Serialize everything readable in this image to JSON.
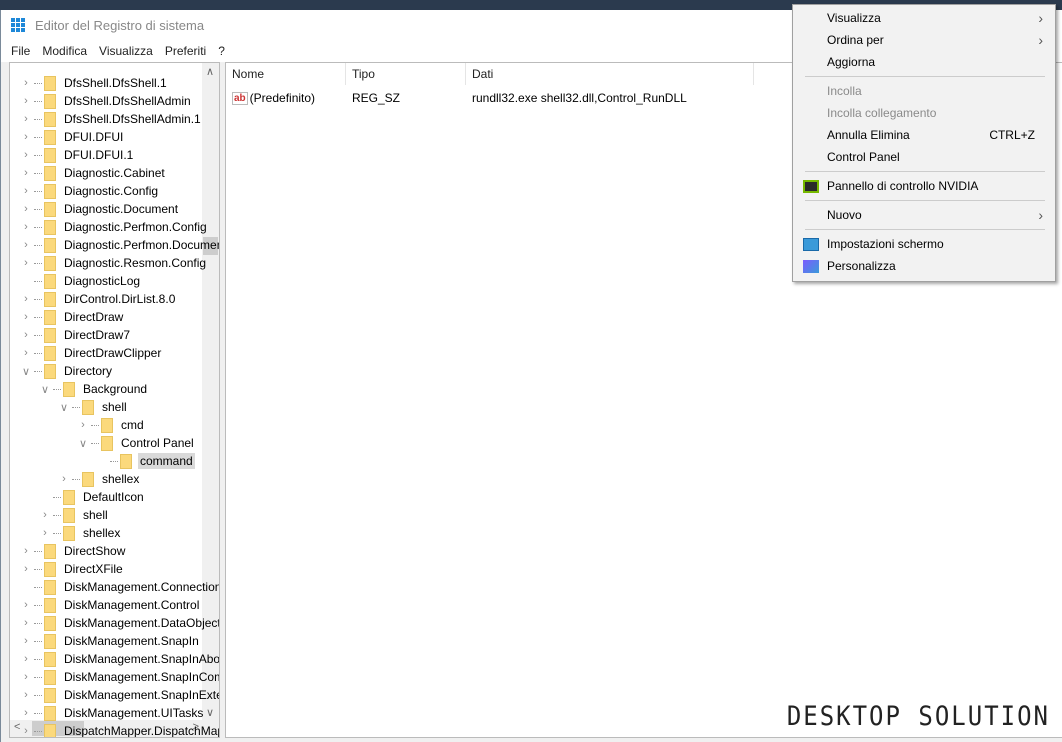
{
  "window": {
    "title": "Editor del Registro di sistema"
  },
  "menubar": [
    "File",
    "Modifica",
    "Visualizza",
    "Preferiti",
    "?"
  ],
  "tree": [
    {
      "label": "DfsShell.DfsShell.1",
      "level": 0,
      "exp": ">"
    },
    {
      "label": "DfsShell.DfsShellAdmin",
      "level": 0,
      "exp": ">"
    },
    {
      "label": "DfsShell.DfsShellAdmin.1",
      "level": 0,
      "exp": ">"
    },
    {
      "label": "DFUI.DFUI",
      "level": 0,
      "exp": ">"
    },
    {
      "label": "DFUI.DFUI.1",
      "level": 0,
      "exp": ">"
    },
    {
      "label": "Diagnostic.Cabinet",
      "level": 0,
      "exp": ">"
    },
    {
      "label": "Diagnostic.Config",
      "level": 0,
      "exp": ">"
    },
    {
      "label": "Diagnostic.Document",
      "level": 0,
      "exp": ">"
    },
    {
      "label": "Diagnostic.Perfmon.Config",
      "level": 0,
      "exp": ">"
    },
    {
      "label": "Diagnostic.Perfmon.Document",
      "level": 0,
      "exp": ">"
    },
    {
      "label": "Diagnostic.Resmon.Config",
      "level": 0,
      "exp": ">"
    },
    {
      "label": "DiagnosticLog",
      "level": 0,
      "exp": ""
    },
    {
      "label": "DirControl.DirList.8.0",
      "level": 0,
      "exp": ">"
    },
    {
      "label": "DirectDraw",
      "level": 0,
      "exp": ">"
    },
    {
      "label": "DirectDraw7",
      "level": 0,
      "exp": ">"
    },
    {
      "label": "DirectDrawClipper",
      "level": 0,
      "exp": ">"
    },
    {
      "label": "Directory",
      "level": 0,
      "exp": "v"
    },
    {
      "label": "Background",
      "level": 1,
      "exp": "v"
    },
    {
      "label": "shell",
      "level": 2,
      "exp": "v"
    },
    {
      "label": "cmd",
      "level": 3,
      "exp": ">"
    },
    {
      "label": "Control Panel",
      "level": 3,
      "exp": "v"
    },
    {
      "label": "command",
      "level": 4,
      "exp": "",
      "selected": true
    },
    {
      "label": "shellex",
      "level": 2,
      "exp": ">"
    },
    {
      "label": "DefaultIcon",
      "level": 1,
      "exp": ""
    },
    {
      "label": "shell",
      "level": 1,
      "exp": ">"
    },
    {
      "label": "shellex",
      "level": 1,
      "exp": ">"
    },
    {
      "label": "DirectShow",
      "level": 0,
      "exp": ">"
    },
    {
      "label": "DirectXFile",
      "level": 0,
      "exp": ">"
    },
    {
      "label": "DiskManagement.Connection",
      "level": 0,
      "exp": ""
    },
    {
      "label": "DiskManagement.Control",
      "level": 0,
      "exp": ">"
    },
    {
      "label": "DiskManagement.DataObject",
      "level": 0,
      "exp": ">"
    },
    {
      "label": "DiskManagement.SnapIn",
      "level": 0,
      "exp": ">"
    },
    {
      "label": "DiskManagement.SnapInAbout",
      "level": 0,
      "exp": ">"
    },
    {
      "label": "DiskManagement.SnapInComponent",
      "level": 0,
      "exp": ">"
    },
    {
      "label": "DiskManagement.SnapInExtension",
      "level": 0,
      "exp": ">"
    },
    {
      "label": "DiskManagement.UITasks",
      "level": 0,
      "exp": ">"
    },
    {
      "label": "DispatchMapper.DispatchMapper",
      "level": 0,
      "exp": ">"
    }
  ],
  "list": {
    "headers": [
      "Nome",
      "Tipo",
      "Dati"
    ],
    "rows": [
      {
        "name": "(Predefinito)",
        "type": "REG_SZ",
        "data": "rundll32.exe shell32.dll,Control_RunDLL"
      }
    ]
  },
  "context_menu": [
    {
      "label": "Visualizza",
      "submenu": true
    },
    {
      "label": "Ordina per",
      "submenu": true
    },
    {
      "label": "Aggiorna"
    },
    {
      "sep": true
    },
    {
      "label": "Incolla",
      "disabled": true
    },
    {
      "label": "Incolla collegamento",
      "disabled": true
    },
    {
      "label": "Annulla Elimina",
      "shortcut": "CTRL+Z"
    },
    {
      "label": "Control Panel"
    },
    {
      "sep": true
    },
    {
      "label": "Pannello di controllo NVIDIA",
      "icon": "nvidia-icon"
    },
    {
      "sep": true
    },
    {
      "label": "Nuovo",
      "submenu": true
    },
    {
      "sep": true
    },
    {
      "label": "Impostazioni schermo",
      "icon": "display-icon"
    },
    {
      "label": "Personalizza",
      "icon": "personalize-icon"
    }
  ],
  "watermark": "DESKTOP SOLUTION"
}
